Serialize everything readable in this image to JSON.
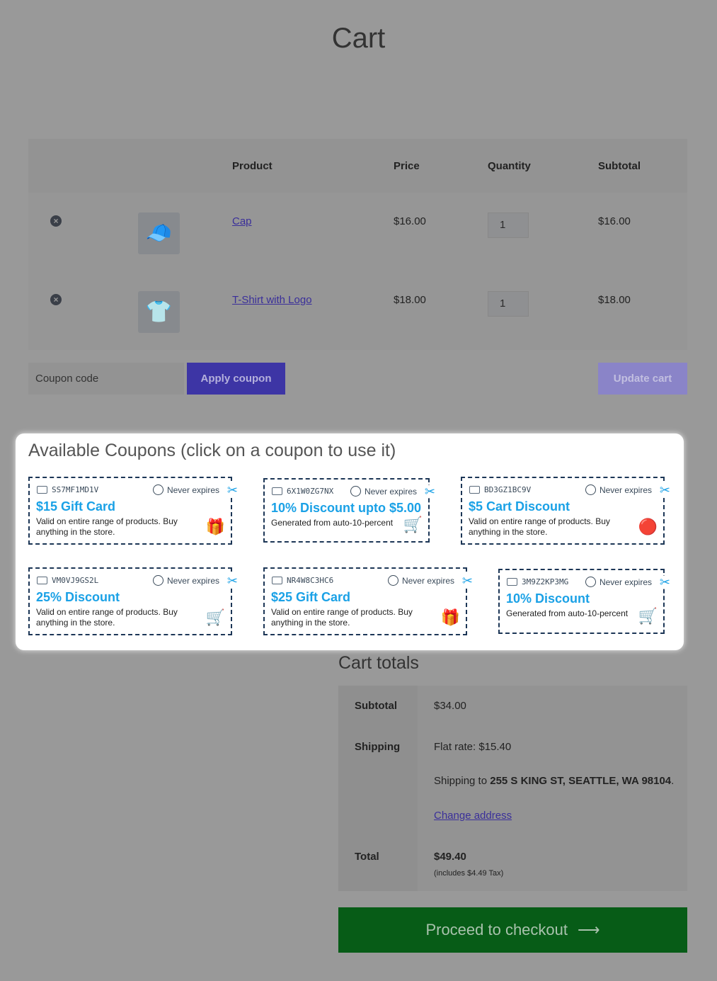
{
  "page": {
    "title": "Cart"
  },
  "table": {
    "headers": {
      "product": "Product",
      "price": "Price",
      "quantity": "Quantity",
      "subtotal": "Subtotal"
    },
    "rows": [
      {
        "name": "Cap",
        "price": "$16.00",
        "qty": "1",
        "subtotal": "$16.00",
        "icon": "cap-image"
      },
      {
        "name": "T-Shirt with Logo",
        "price": "$18.00",
        "qty": "1",
        "subtotal": "$18.00",
        "icon": "tshirt-image"
      }
    ]
  },
  "actions": {
    "coupon_placeholder": "Coupon code",
    "apply": "Apply coupon",
    "update": "Update cart"
  },
  "coupons": {
    "title": "Available Coupons (click on a coupon to use it)",
    "items": [
      {
        "code": "SS7MF1MD1V",
        "expiry": "Never expires",
        "title": "$15 Gift Card",
        "desc": "Valid on entire range of products. Buy anything in the store.",
        "icon": "gift-icon"
      },
      {
        "code": "6X1W0ZG7NX",
        "expiry": "Never expires",
        "title": "10% Discount upto $5.00",
        "desc": "Generated from auto-10-percent",
        "icon": "cart-icon"
      },
      {
        "code": "BD3GZ1BC9V",
        "expiry": "Never expires",
        "title": "$5 Cart Discount",
        "desc": "Valid on entire range of products. Buy anything in the store.",
        "icon": "sale-badge-icon"
      },
      {
        "code": "VM0VJ9GS2L",
        "expiry": "Never expires",
        "title": "25% Discount",
        "desc": "Valid on entire range of products. Buy anything in the store.",
        "icon": "cart-icon"
      },
      {
        "code": "NR4W8C3HC6",
        "expiry": "Never expires",
        "title": "$25 Gift Card",
        "desc": "Valid on entire range of products. Buy anything in the store.",
        "icon": "gift-icon"
      },
      {
        "code": "3M9Z2KP3MG",
        "expiry": "Never expires",
        "title": "10% Discount",
        "desc": "Generated from auto-10-percent",
        "icon": "cart-icon"
      }
    ]
  },
  "totals": {
    "title": "Cart totals",
    "subtotal_label": "Subtotal",
    "subtotal": "$34.00",
    "shipping_label": "Shipping",
    "shipping_rate": "Flat rate: $15.40",
    "shipping_to_prefix": "Shipping to ",
    "shipping_address": "255 S KING ST, SEATTLE, WA 98104",
    "change_address": "Change address",
    "total_label": "Total",
    "total": "$49.40",
    "tax_note": "(includes $4.49 Tax)"
  },
  "checkout": {
    "label": "Proceed to checkout"
  },
  "colors": {
    "accent": "#1aa1e6",
    "button": "#3d35a5",
    "checkout": "#075c17"
  }
}
